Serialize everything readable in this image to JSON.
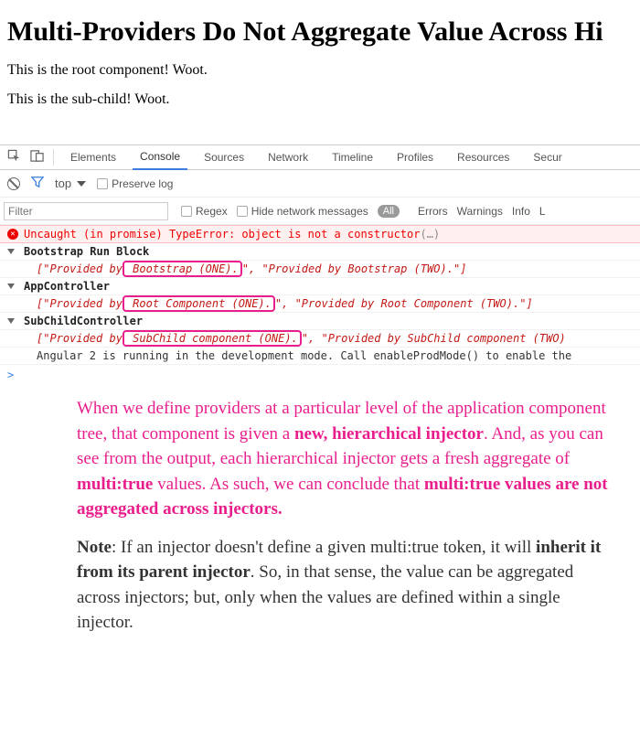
{
  "page": {
    "title": "Multi-Providers Do Not Aggregate Value Across Hi",
    "line1": "This is the root component! Woot.",
    "line2": "This is the sub-child! Woot."
  },
  "devtools": {
    "tabs": {
      "elements": "Elements",
      "console": "Console",
      "sources": "Sources",
      "network": "Network",
      "timeline": "Timeline",
      "profiles": "Profiles",
      "resources": "Resources",
      "security": "Secur"
    },
    "subbar": {
      "top": "top",
      "preserve": "Preserve log"
    },
    "filterbar": {
      "placeholder": "Filter",
      "regex": "Regex",
      "hide": "Hide network messages",
      "all": "All",
      "errors": "Errors",
      "warnings": "Warnings",
      "info": "Info",
      "logs": "L"
    }
  },
  "console": {
    "error": {
      "text": "Uncaught (in promise) TypeError: object is not a constructor",
      "tail": "(…)"
    },
    "groups": [
      {
        "header": "Bootstrap Run Block",
        "arr_open": "[",
        "q1a": "\"Provided by",
        "hl": " Bootstrap (ONE).",
        "q1b": "\"",
        "sep": ", ",
        "q2": "\"Provided by Bootstrap (TWO).\"",
        "arr_close": "]"
      },
      {
        "header": "AppController",
        "arr_open": "[",
        "q1a": "\"Provided by",
        "hl": " Root Component (ONE).",
        "q1b": "\"",
        "sep": ", ",
        "q2": "\"Provided by Root Component (TWO).\"",
        "arr_close": "]"
      },
      {
        "header": "SubChildController",
        "arr_open": "[",
        "q1a": "\"Provided by",
        "hl": " SubChild component (ONE).",
        "q1b": "\"",
        "sep": ", ",
        "q2": "\"Provided by SubChild component (TWO)",
        "arr_close": ""
      }
    ],
    "devmode": "Angular 2 is running in the development mode. Call enableProdMode() to enable the",
    "prompt": ">"
  },
  "annotation": {
    "p1_a": "When we define providers at a particular level of the application component tree, that component is given a ",
    "p1_b": "new, hierarchical injector",
    "p1_c": ". And, as you can see from the output, each hierarchical injector gets a fresh aggregate of ",
    "p1_d": "multi:true",
    "p1_e": " values. As such, we can conclude that ",
    "p1_f": "multi:true values are not aggregated across injectors.",
    "p2_a": "Note",
    "p2_b": ": If an injector doesn't define a given multi:true token, it will ",
    "p2_c": "inherit it from its parent injector",
    "p2_d": ". So, in that sense, the value can be aggregated across injectors; but, only when the values are defined within a single injector."
  }
}
